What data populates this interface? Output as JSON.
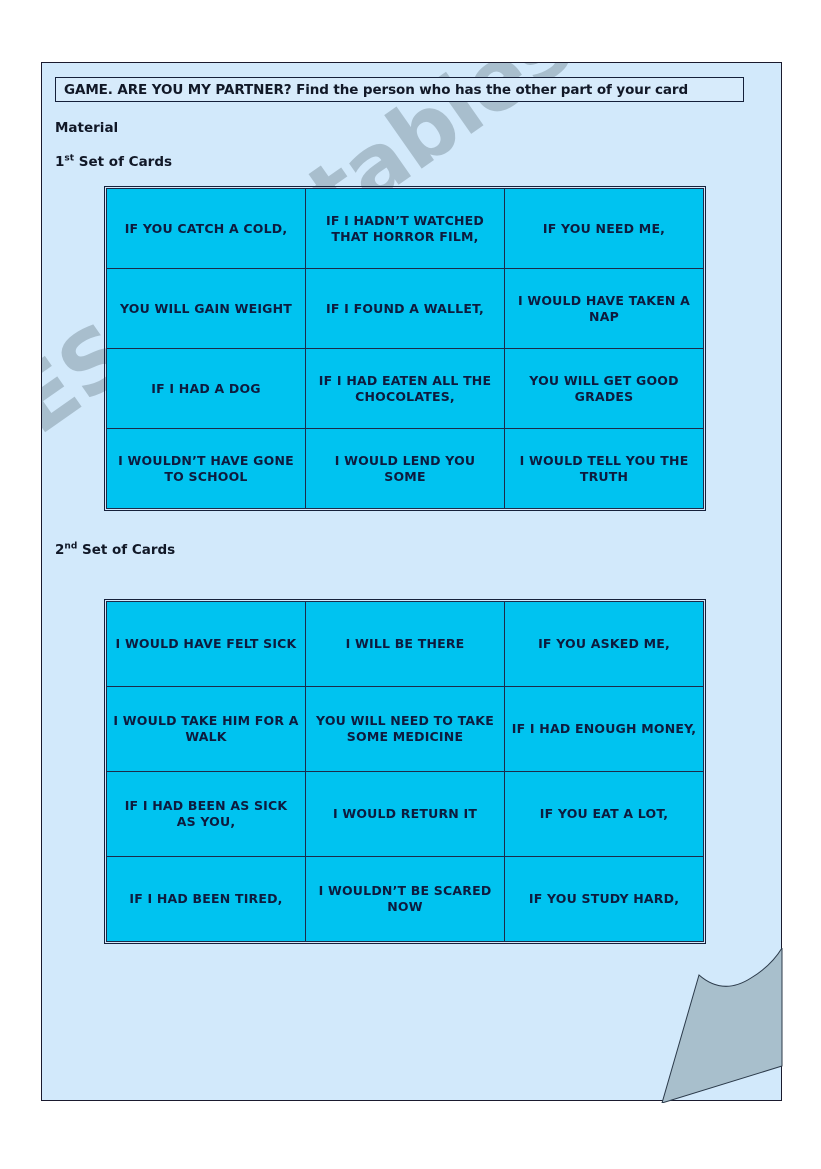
{
  "document": {
    "title": "GAME. ARE YOU MY PARTNER? Find the person who has the other part of your card",
    "material_label": "Material",
    "set1_label_number": "1",
    "set1_label_ordinal": "st",
    "set1_label_rest": " Set of Cards",
    "set2_label_number": "2",
    "set2_label_ordinal": "nd",
    "set2_label_rest": " Set of Cards",
    "watermark": "ESLprintables.com",
    "colors": {
      "page_background": "#d2e9fb",
      "card_fill": "#00c3f0",
      "card_border": "#1b2a4a",
      "text": "#0d1b3e",
      "title_box_fill": "#d7ebfb",
      "curl_fill": "#a8bfcc"
    }
  },
  "set1": {
    "rows": [
      [
        "IF YOU CATCH A COLD,",
        "IF I HADN’T WATCHED THAT HORROR FILM,",
        "IF YOU NEED ME,"
      ],
      [
        "YOU WILL GAIN WEIGHT",
        "IF I FOUND A WALLET,",
        "I WOULD HAVE TAKEN A NAP"
      ],
      [
        "IF I HAD A DOG",
        "IF I HAD EATEN ALL THE CHOCOLATES,",
        "YOU WILL GET GOOD GRADES"
      ],
      [
        "I WOULDN’T HAVE GONE TO SCHOOL",
        "I WOULD LEND YOU SOME",
        "I WOULD TELL YOU THE TRUTH"
      ]
    ]
  },
  "set2": {
    "rows": [
      [
        "I WOULD HAVE FELT SICK",
        "I WILL BE THERE",
        "IF YOU ASKED ME,"
      ],
      [
        "I WOULD TAKE HIM FOR A WALK",
        "YOU WILL NEED TO TAKE SOME MEDICINE",
        "IF I HAD ENOUGH MONEY,"
      ],
      [
        "IF I HAD BEEN AS SICK AS YOU,",
        "I WOULD RETURN IT",
        "IF YOU EAT A LOT,"
      ],
      [
        "IF I HAD BEEN TIRED,",
        "I WOULDN’T BE SCARED NOW",
        "IF YOU STUDY HARD,"
      ]
    ]
  }
}
